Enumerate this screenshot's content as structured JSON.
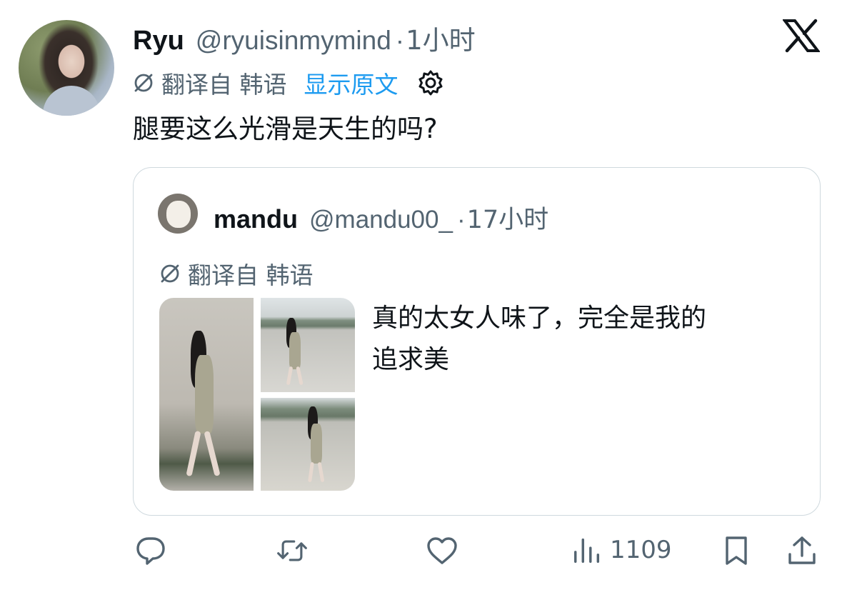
{
  "tweet": {
    "display_name": "Ryu",
    "handle": "@ryuisinmymind",
    "dot": "·",
    "time": "1小时",
    "translated_from": "翻译自 韩语",
    "show_original": "显示原文",
    "text": "腿要这么光滑是天生的吗?"
  },
  "quote": {
    "display_name": "mandu",
    "handle": "@mandu00_",
    "dot": "·",
    "time": "17小时",
    "translated_from": "翻译自 韩语",
    "text_line1": "真的太女人味了，完全是我的",
    "text_line2": "追求美"
  },
  "actions": {
    "reply_icon": "reply-icon",
    "retweet_icon": "retweet-icon",
    "like_icon": "like-icon",
    "views_icon": "views-icon",
    "views_count": "1109",
    "bookmark_icon": "bookmark-icon",
    "share_icon": "share-icon"
  },
  "colors": {
    "text": "#0f1419",
    "secondary": "#536471",
    "link": "#1d9bf0",
    "border": "#cfd9de"
  }
}
